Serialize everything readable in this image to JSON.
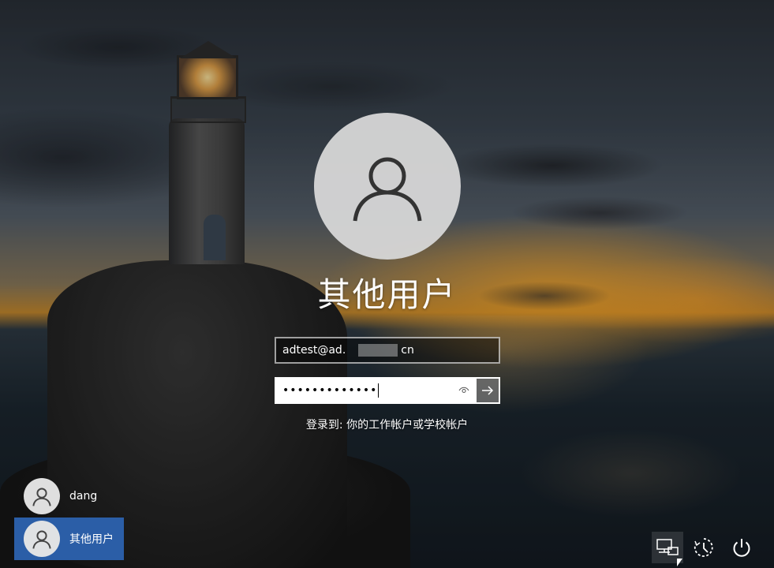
{
  "login": {
    "display_name": "其他用户",
    "username_prefix": "adtest@ad.",
    "username_suffix": "cn",
    "password_mask": "•••••••••••••",
    "sign_in_to": "登录到: 你的工作帐户或学校帐户"
  },
  "users": [
    {
      "name": "dang",
      "selected": false
    },
    {
      "name": "其他用户",
      "selected": true
    }
  ],
  "system_buttons": [
    "network-icon",
    "accessibility-icon",
    "power-icon"
  ],
  "colors": {
    "selected_tile": "#2b5ea7",
    "avatar_bg": "#d7d7d7"
  }
}
